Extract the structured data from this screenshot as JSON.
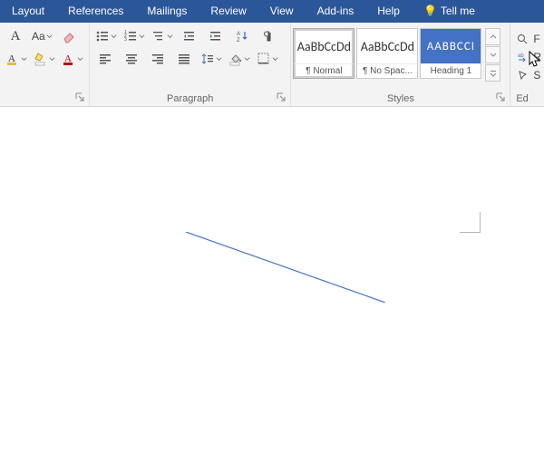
{
  "tabs": {
    "items": [
      "Layout",
      "References",
      "Mailings",
      "Review",
      "View",
      "Add-ins",
      "Help"
    ],
    "tellme": "Tell me"
  },
  "font": {
    "grow": "A",
    "shrink": "A",
    "case": "Aa",
    "clear": "✓"
  },
  "paragraph": {
    "label": "Paragraph"
  },
  "styles": {
    "label": "Styles",
    "preview": "AaBbCcDd",
    "preview_h1": "AABBCCI",
    "items": [
      {
        "name": "¶ Normal"
      },
      {
        "name": "¶ No Spac..."
      },
      {
        "name": "Heading 1"
      }
    ]
  },
  "editing": {
    "label": "Ed",
    "find": "F",
    "replace": "R",
    "select": "S"
  },
  "icons": {
    "bulb": "💡"
  }
}
